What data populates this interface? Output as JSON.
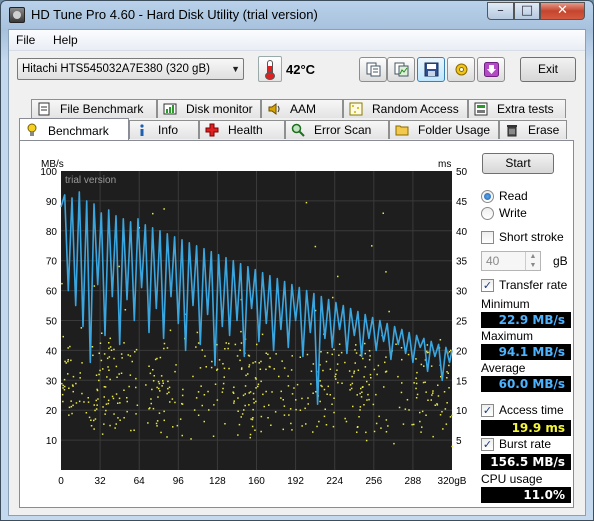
{
  "window": {
    "title": "HD Tune Pro 4.60 - Hard Disk Utility (trial version)",
    "controls": {
      "minimize": "–",
      "maximize": "□",
      "close": "✕"
    }
  },
  "menu": [
    {
      "label": "File"
    },
    {
      "label": "Help"
    }
  ],
  "toolbar": {
    "drive": "Hitachi HTS545032A7E380 (320 gB)",
    "temperature": "42°C",
    "buttons": [
      {
        "icon": "copy-text-icon"
      },
      {
        "icon": "copy-screenshot-icon"
      },
      {
        "icon": "save-icon"
      },
      {
        "icon": "options-icon"
      },
      {
        "icon": "download-icon"
      }
    ],
    "exit_label": "Exit"
  },
  "tabs_top": [
    {
      "label": "File Benchmark",
      "icon": "file-benchmark-icon"
    },
    {
      "label": "Disk monitor",
      "icon": "disk-monitor-icon"
    },
    {
      "label": "AAM",
      "icon": "speaker-icon"
    },
    {
      "label": "Random Access",
      "icon": "random-access-icon"
    },
    {
      "label": "Extra tests",
      "icon": "extra-tests-icon"
    }
  ],
  "tabs_bottom": [
    {
      "label": "Benchmark",
      "icon": "benchmark-icon",
      "selected": true
    },
    {
      "label": "Info",
      "icon": "info-icon"
    },
    {
      "label": "Health",
      "icon": "health-cross-icon"
    },
    {
      "label": "Error Scan",
      "icon": "error-scan-icon"
    },
    {
      "label": "Folder Usage",
      "icon": "folder-icon"
    },
    {
      "label": "Erase",
      "icon": "erase-bin-icon"
    }
  ],
  "panel": {
    "start_label": "Start",
    "read_label": "Read",
    "write_label": "Write",
    "short_stroke_label": "Short stroke",
    "short_stroke_value": "40",
    "short_stroke_unit": "gB",
    "transfer_rate_label": "Transfer rate",
    "minimum_label": "Minimum",
    "minimum_value": "22.9 MB/s",
    "maximum_label": "Maximum",
    "maximum_value": "94.1 MB/s",
    "average_label": "Average",
    "average_value": "60.0 MB/s",
    "access_time_label": "Access time",
    "access_time_value": "19.9 ms",
    "burst_rate_label": "Burst rate",
    "burst_rate_value": "156.5 MB/s",
    "cpu_usage_label": "CPU usage",
    "cpu_usage_value": "11.0%",
    "read_selected": true,
    "short_stroke_checked": false,
    "transfer_rate_checked": true,
    "access_time_checked": true,
    "burst_rate_checked": true
  },
  "chart_data": {
    "type": "line",
    "watermark": "trial version",
    "y_left_label": "MB/s",
    "y_right_label": "ms",
    "x_unit": "gB",
    "xlim": [
      0,
      320
    ],
    "ylim_left": [
      0,
      100
    ],
    "ylim_right": [
      0,
      50
    ],
    "x_ticks": [
      "0",
      "32",
      "64",
      "96",
      "128",
      "160",
      "192",
      "224",
      "256",
      "288",
      "320gB"
    ],
    "y_left_ticks": [
      "10",
      "20",
      "30",
      "40",
      "50",
      "60",
      "70",
      "80",
      "90",
      "100"
    ],
    "y_right_ticks": [
      "5",
      "10",
      "15",
      "20",
      "25",
      "30",
      "35",
      "40",
      "45",
      "50"
    ],
    "grid": true,
    "colors": {
      "background": "#1e1e1e",
      "grid": "#3a3a3a",
      "transfer": "#3aa6e0",
      "access": "#e8e84a"
    },
    "series": [
      {
        "kind": "transfer",
        "unit": "MB/s",
        "x": [
          0,
          3,
          6,
          9,
          12,
          15,
          18,
          21,
          24,
          27,
          30,
          33,
          36,
          39,
          42,
          45,
          48,
          51,
          54,
          57,
          60,
          63,
          66,
          69,
          72,
          75,
          78,
          81,
          84,
          87,
          90,
          93,
          96,
          99,
          102,
          105,
          108,
          111,
          114,
          117,
          120,
          123,
          126,
          129,
          132,
          135,
          138,
          141,
          144,
          147,
          150,
          153,
          156,
          159,
          162,
          165,
          168,
          171,
          174,
          177,
          180,
          183,
          186,
          189,
          192,
          195,
          198,
          201,
          204,
          207,
          210,
          213,
          216,
          219,
          222,
          225,
          228,
          231,
          234,
          237,
          240,
          243,
          246,
          249,
          252,
          255,
          258,
          261,
          264,
          267,
          270,
          273,
          276,
          279,
          282,
          285,
          288,
          291,
          294,
          297,
          300,
          303,
          306,
          309,
          312,
          315,
          318,
          320
        ],
        "y": [
          88,
          92,
          60,
          91,
          55,
          93,
          48,
          90,
          36,
          89,
          62,
          86,
          45,
          87,
          58,
          85,
          42,
          84,
          57,
          83,
          50,
          84,
          61,
          82,
          46,
          81,
          54,
          80,
          44,
          79,
          58,
          78,
          49,
          77,
          40,
          76,
          55,
          75,
          42,
          74,
          52,
          73,
          35,
          72,
          48,
          71,
          45,
          70,
          50,
          69,
          38,
          68,
          54,
          67,
          43,
          66,
          49,
          65,
          40,
          64,
          47,
          63,
          41,
          62,
          50,
          61,
          38,
          60,
          46,
          59,
          22,
          58,
          44,
          57,
          41,
          56,
          47,
          55,
          39,
          54,
          45,
          53,
          38,
          52,
          44,
          51,
          40,
          50,
          43,
          49,
          37,
          48,
          42,
          47,
          39,
          46,
          36,
          45,
          41,
          44,
          33,
          43,
          38,
          42,
          30,
          41,
          36,
          40
        ]
      },
      {
        "kind": "access",
        "unit": "ms",
        "description": "Yellow scatter of access times, clustered roughly 8–25 ms across the disk"
      }
    ]
  }
}
